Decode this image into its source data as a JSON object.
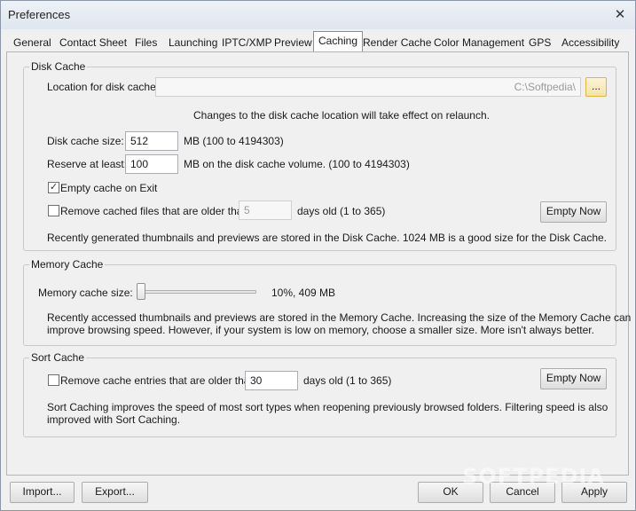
{
  "window": {
    "title": "Preferences",
    "close_glyph": "✕"
  },
  "tabs": [
    "General",
    "Contact Sheet",
    "Files",
    "Launching",
    "IPTC/XMP",
    "Preview",
    "Caching",
    "Render Cache",
    "Color Management",
    "GPS",
    "Accessibility"
  ],
  "active_tab": "Caching",
  "disk_cache": {
    "title": "Disk Cache",
    "location_label": "Location for disk cache:",
    "location_value": "C:\\Softpedia\\",
    "browse_label": "...",
    "relaunch_note": "Changes to the disk cache location will take effect on relaunch.",
    "size_label": "Disk cache size:",
    "size_value": "512",
    "size_hint": "MB (100 to 4194303)",
    "reserve_label": "Reserve at least:",
    "reserve_value": "100",
    "reserve_hint": "MB on the disk cache volume. (100 to 4194303)",
    "empty_on_exit_label": "Empty cache on Exit",
    "empty_on_exit_checked": true,
    "remove_older_label": "Remove cached files that are older than",
    "remove_older_checked": false,
    "remove_older_value": "5",
    "remove_older_hint": "days old (1 to 365)",
    "empty_now_label": "Empty Now",
    "footer_note": "Recently generated thumbnails and previews are stored in the Disk Cache.  1024 MB is a good size for the Disk Cache."
  },
  "memory_cache": {
    "title": "Memory Cache",
    "size_label": "Memory cache size:",
    "slider_percent": 10,
    "slider_readout": "10%, 409 MB",
    "note_line1": "Recently accessed thumbnails and previews are stored in the Memory Cache.  Increasing the size of the Memory Cache can",
    "note_line2": "improve browsing speed.  However, if your system is low on memory, choose a smaller size.  More isn't always better."
  },
  "sort_cache": {
    "title": "Sort Cache",
    "remove_older_label": "Remove cache entries that are older than",
    "remove_older_checked": false,
    "remove_older_value": "30",
    "remove_older_hint": "days old (1 to 365)",
    "empty_now_label": "Empty Now",
    "note_line1": "Sort Caching improves the speed of most sort types when reopening previously browsed folders.  Filtering speed is also",
    "note_line2": "improved with Sort Caching."
  },
  "footer": {
    "import_label": "Import...",
    "export_label": "Export...",
    "ok_label": "OK",
    "cancel_label": "Cancel",
    "apply_label": "Apply"
  },
  "watermark": "SOFTPEDIA",
  "check_glyph": "✓"
}
